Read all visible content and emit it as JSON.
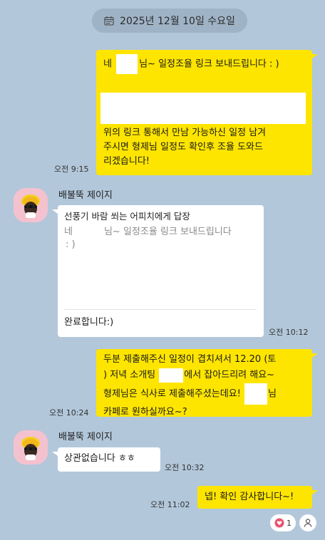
{
  "date_divider": {
    "text": "2025년 12월 10일 수요일",
    "icon": "calendar-icon"
  },
  "messages": [
    {
      "type": "me",
      "lines": [
        {
          "pre": "네 ",
          "post": "님~ 일정조율 링크 보내드립니다 : )"
        },
        "위의 링크 통해서 만남 가능하신 일정 남겨",
        "주시면 형제님 일정도 확인후 조율 도와드",
        "리겠습니다!"
      ],
      "time": "오전 9:15"
    },
    {
      "type": "other",
      "sender": "배불뚝 제이지",
      "reply_to": "선풍기 바람 쐬는 어피치에게 답장",
      "quoted_line1_pre": "네",
      "quoted_line1_post": "님~ 일정조율 링크 보내드립니다",
      "quoted_line2": ": )",
      "body": "완료합니다:)",
      "time": "오전 10:12"
    },
    {
      "type": "me",
      "line1": "두분 제출해주신 일정이 겹치셔서 12.20 (토",
      "line2_pre": ") 저녁 소개팅 ",
      "line2_post": "에서 잡아드리려 해요~",
      "line3_pre": "형제님은 식사로 제출해주셨는데요! ",
      "line3_post": "님",
      "line4": " 카페로 원하실까요~?",
      "time": "오전 10:24"
    },
    {
      "type": "other",
      "sender": "배불뚝 제이지",
      "body": "상관없습니다 ㅎㅎ",
      "time": "오전 10:32"
    },
    {
      "type": "me",
      "body": "넵! 확인 감사합니다~!",
      "time": "오전 11:02"
    }
  ],
  "reaction": {
    "icon": "heart-icon",
    "count": "1"
  },
  "reaction_user_icon": "person-icon",
  "colors": {
    "background": "#b2c7da",
    "my_bubble": "#fee500",
    "other_bubble": "#ffffff",
    "heart": "#e8546f"
  }
}
